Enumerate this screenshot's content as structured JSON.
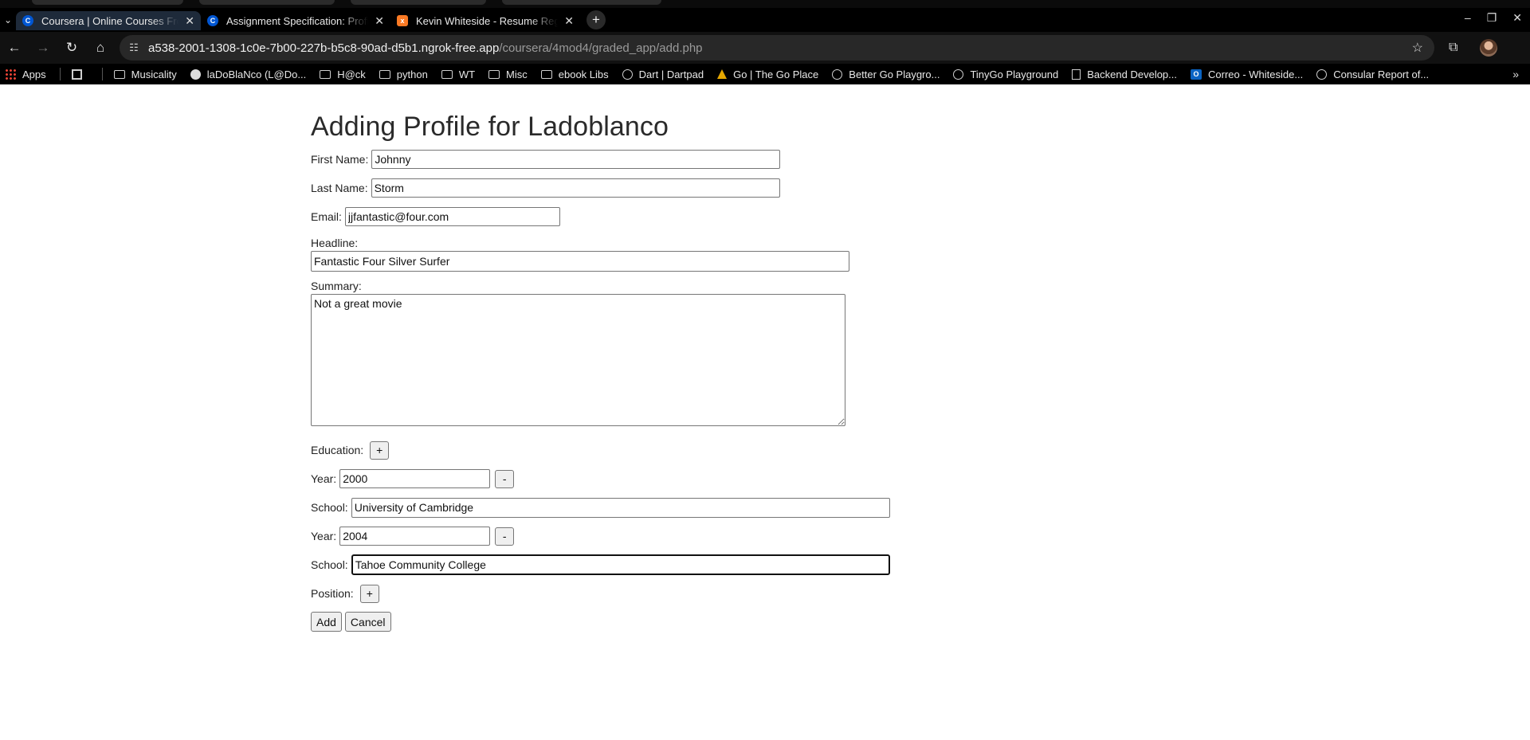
{
  "browser": {
    "tabs": [
      {
        "title": "Coursera | Online Courses From Top Universities",
        "icon": "coursera-icon",
        "active": true
      },
      {
        "title": "Assignment Specification: Profiles, Positions, and Education",
        "icon": "coursera-icon",
        "active": false
      },
      {
        "title": "Kevin Whiteside - Resume Registry",
        "icon": "xampp-icon",
        "active": false
      }
    ],
    "url_host": "a538-2001-1308-1c0e-7b00-227b-b5c8-90ad-d5b1.ngrok-free.app",
    "url_path": "/coursera/4mod4/graded_app/add.php",
    "bookmarks": [
      {
        "label": "Apps",
        "icon": "apps-icon"
      },
      {
        "label": "Musicality",
        "icon": "folder-icon"
      },
      {
        "label": "laDoBlaNco (L@Do...",
        "icon": "github-icon"
      },
      {
        "label": "H@ck",
        "icon": "folder-icon"
      },
      {
        "label": "python",
        "icon": "folder-icon"
      },
      {
        "label": "WT",
        "icon": "folder-icon"
      },
      {
        "label": "Misc",
        "icon": "folder-icon"
      },
      {
        "label": "ebook Libs",
        "icon": "folder-icon"
      },
      {
        "label": "Dart | Dartpad",
        "icon": "globe-icon"
      },
      {
        "label": "Go | The Go Place",
        "icon": "tree-icon"
      },
      {
        "label": "Better Go Playgro...",
        "icon": "globe-icon"
      },
      {
        "label": "TinyGo Playground",
        "icon": "globe-icon"
      },
      {
        "label": "Backend Develop...",
        "icon": "doc-icon"
      },
      {
        "label": "Correo - Whiteside...",
        "icon": "outlook-icon"
      },
      {
        "label": "Consular Report of...",
        "icon": "globe-icon"
      }
    ]
  },
  "form": {
    "heading": "Adding Profile for Ladoblanco",
    "first_name": {
      "label": "First Name:",
      "value": "Johnny"
    },
    "last_name": {
      "label": "Last Name:",
      "value": "Storm"
    },
    "email": {
      "label": "Email:",
      "value": "jjfantastic@four.com"
    },
    "headline": {
      "label": "Headline:",
      "value": "Fantastic Four Silver Surfer"
    },
    "summary": {
      "label": "Summary:",
      "value": "Not a great movie"
    },
    "education": {
      "label": "Education:",
      "add_label": "+"
    },
    "education_entries": [
      {
        "year_label": "Year:",
        "year": "2000",
        "remove_label": "-",
        "school_label": "School:",
        "school": "University of Cambridge"
      },
      {
        "year_label": "Year:",
        "year": "2004",
        "remove_label": "-",
        "school_label": "School:",
        "school": "Tahoe Community College"
      }
    ],
    "position": {
      "label": "Position:",
      "add_label": "+"
    },
    "submit_label": "Add",
    "cancel_label": "Cancel"
  }
}
